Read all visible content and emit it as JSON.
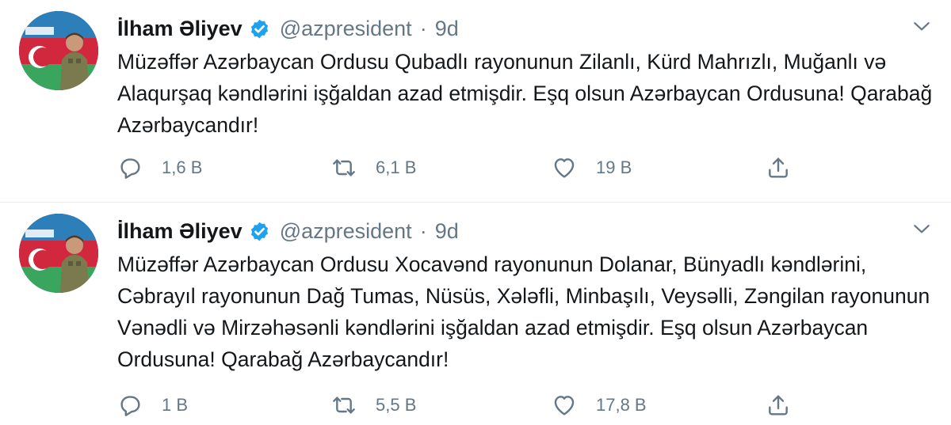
{
  "tweets": [
    {
      "author": {
        "name": "İlham Əliyev",
        "handle": "@azpresident",
        "verified": true
      },
      "separator": "·",
      "time": "9d",
      "text": "Müzəffər Azərbaycan Ordusu Qubadlı rayonunun Zilanlı, Kürd Mahrızlı, Muğanlı və Alaqurşaq kəndlərini işğaldan azad etmişdir. Eşq olsun Azərbaycan Ordusuna! Qarabağ Azərbaycandır!",
      "actions": {
        "replies": "1,6 B",
        "retweets": "6,1 B",
        "likes": "19 B"
      }
    },
    {
      "author": {
        "name": "İlham Əliyev",
        "handle": "@azpresident",
        "verified": true
      },
      "separator": "·",
      "time": "9d",
      "text": "Müzəffər Azərbaycan Ordusu Xocavənd rayonunun Dolanar, Bünyadlı kəndlərini, Cəbrayıl rayonunun Dağ Tumas, Nüsüs, Xələfli, Minbaşılı, Veysəlli, Zəngilan rayonunun Vənədli və Mirzəhəsənli kəndlərini işğaldan azad etmişdir. Eşq olsun Azərbaycan Ordusuna! Qarabağ Azərbaycandır!",
      "actions": {
        "replies": "1 B",
        "retweets": "5,5 B",
        "likes": "17,8 B"
      }
    }
  ],
  "icons": {
    "verified": "verified-badge-icon",
    "more": "chevron-down-icon",
    "reply": "reply-icon",
    "retweet": "retweet-icon",
    "like": "heart-icon",
    "share": "share-icon"
  },
  "colors": {
    "verified": "#1da1f2",
    "muted": "#657786",
    "text": "#14171a",
    "divider": "#e6ecf0"
  }
}
